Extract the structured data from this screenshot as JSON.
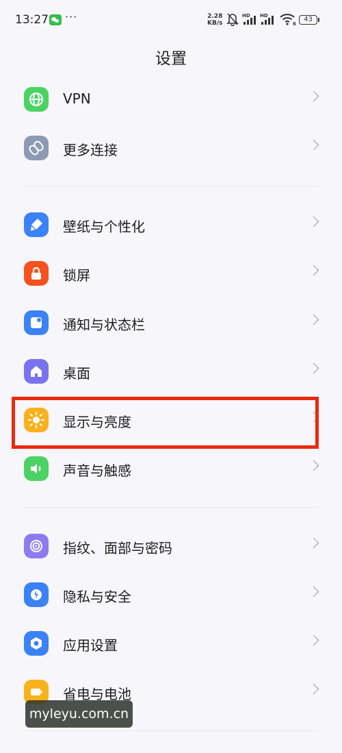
{
  "status_bar": {
    "time": "13:27",
    "more": "···",
    "net_speed_value": "2.28",
    "net_speed_unit": "KB/s",
    "signal_label_1": "HD",
    "signal_label_2": "HD",
    "wifi_label": "6",
    "battery": "43",
    "icons": [
      "wechat-icon",
      "dnd-bell-off-icon",
      "signal-icon",
      "wifi-icon",
      "battery-icon"
    ]
  },
  "header": {
    "title": "设置"
  },
  "settings": [
    {
      "label": "VPN",
      "icon": "globe-icon",
      "color": "#4cd263"
    },
    {
      "label": "更多连接",
      "icon": "link-icon",
      "color": "#8c9ab4"
    },
    {
      "label": "壁纸与个性化",
      "icon": "brush-icon",
      "color": "#3b82f6"
    },
    {
      "label": "锁屏",
      "icon": "lock-icon",
      "color": "#f4511e"
    },
    {
      "label": "通知与状态栏",
      "icon": "notification-icon",
      "color": "#3b82f6"
    },
    {
      "label": "桌面",
      "icon": "home-icon",
      "color": "#7a73f0"
    },
    {
      "label": "显示与亮度",
      "icon": "sun-icon",
      "color": "#f9b21d"
    },
    {
      "label": "声音与触感",
      "icon": "speaker-icon",
      "color": "#4cd263"
    },
    {
      "label": "指纹、面部与密码",
      "icon": "fingerprint-icon",
      "color": "#8d7cf0"
    },
    {
      "label": "隐私与安全",
      "icon": "privacy-shield-icon",
      "color": "#3b82f6"
    },
    {
      "label": "应用设置",
      "icon": "app-gear-icon",
      "color": "#3b82f6"
    },
    {
      "label": "省电与电池",
      "icon": "battery-saver-icon",
      "color": "#f9b21d"
    }
  ],
  "highlight_color": "#ea2a0e",
  "watermark": "myleyu.com.cn"
}
